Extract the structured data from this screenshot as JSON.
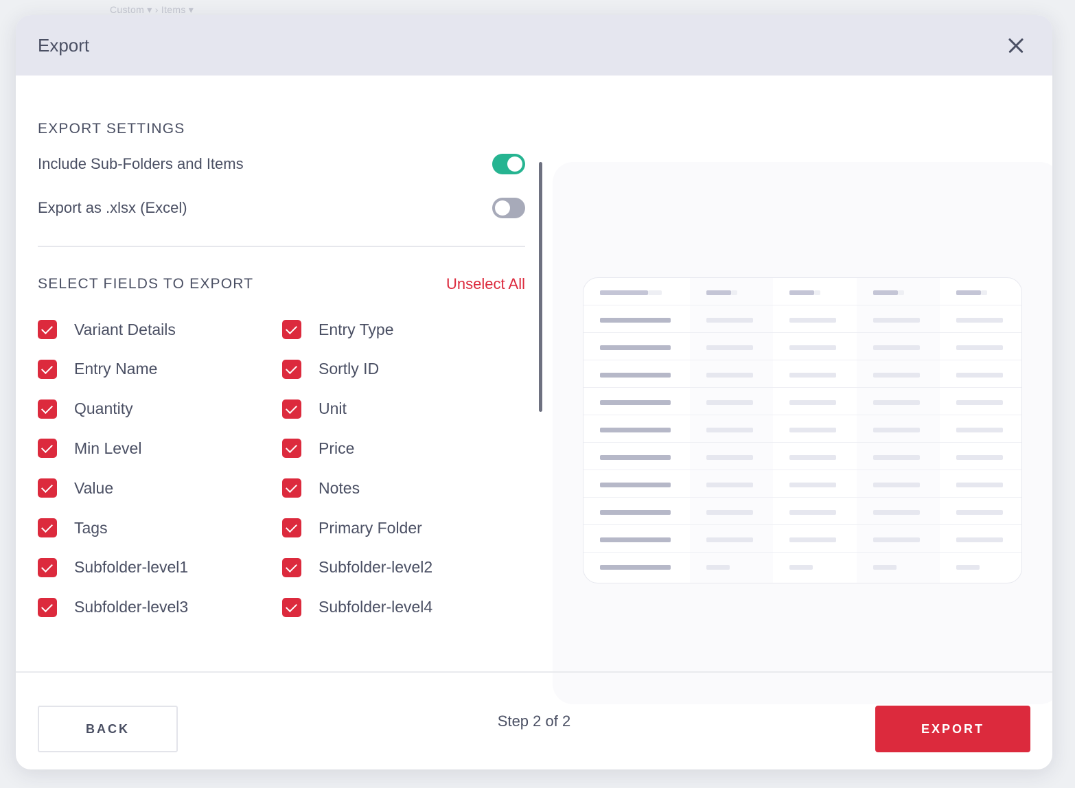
{
  "backdrop": {
    "breadcrumb": "Custom ▾   ›   Items ▾"
  },
  "header": {
    "title": "Export"
  },
  "settings": {
    "title": "EXPORT SETTINGS",
    "options": [
      {
        "label": "Include Sub-Folders and Items",
        "enabled": true
      },
      {
        "label": "Export as .xlsx (Excel)",
        "enabled": false
      }
    ]
  },
  "fields": {
    "title": "SELECT FIELDS TO EXPORT",
    "unselect_all": "Unselect All",
    "items": [
      {
        "label": "Variant Details",
        "checked": true
      },
      {
        "label": "Entry Type",
        "checked": true
      },
      {
        "label": "Entry Name",
        "checked": true
      },
      {
        "label": "Sortly ID",
        "checked": true
      },
      {
        "label": "Quantity",
        "checked": true
      },
      {
        "label": "Unit",
        "checked": true
      },
      {
        "label": "Min Level",
        "checked": true
      },
      {
        "label": "Price",
        "checked": true
      },
      {
        "label": "Value",
        "checked": true
      },
      {
        "label": "Notes",
        "checked": true
      },
      {
        "label": "Tags",
        "checked": true
      },
      {
        "label": "Primary Folder",
        "checked": true
      },
      {
        "label": "Subfolder-level1",
        "checked": true
      },
      {
        "label": "Subfolder-level2",
        "checked": true
      },
      {
        "label": "Subfolder-level3",
        "checked": true
      },
      {
        "label": "Subfolder-level4",
        "checked": true
      }
    ]
  },
  "footer": {
    "back_label": "BACK",
    "step_text": "Step 2 of 2",
    "export_label": "EXPORT"
  },
  "colors": {
    "accent": "#dc2a3d",
    "toggle_on": "#26b491",
    "toggle_off": "#a7aab9",
    "header_bg": "#e5e6ef"
  },
  "icons": {
    "close": "close-icon",
    "checkbox": "check-icon"
  }
}
